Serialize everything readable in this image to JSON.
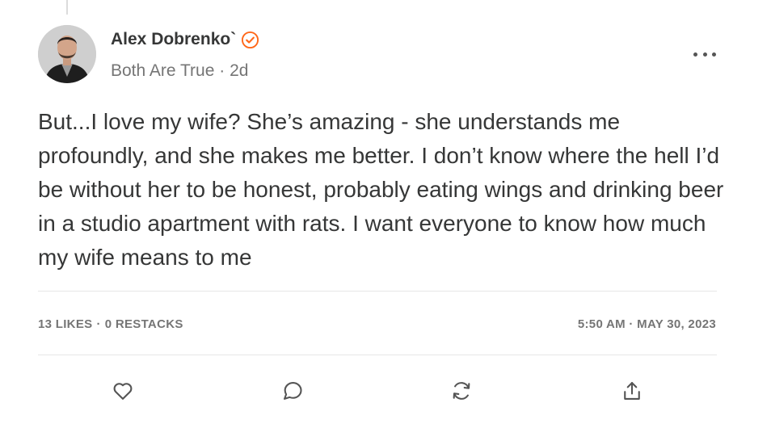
{
  "post": {
    "author_name": "Alex Dobrenko`",
    "publication": "Both Are True",
    "meta_sep": "·",
    "age": "2d",
    "body": "But...I love my wife? She’s amazing - she understands me profoundly, and she makes me better. I don’t know where the hell I’d be without her to be honest, probably eating wings and drinking beer in a studio apartment with rats. I want everyone to know how much my wife means to me"
  },
  "stats": {
    "likes": "13 LIKES",
    "sep": "·",
    "restacks": "0 RESTACKS",
    "timestamp": "5:50 AM · MAY 30, 2023"
  },
  "icons": {
    "verified": "verified-badge-icon",
    "more": "more-horizontal-icon",
    "like": "heart-icon",
    "comment": "comment-icon",
    "restack": "restack-icon",
    "share": "share-icon"
  },
  "colors": {
    "accent": "#FF6719",
    "text": "#363737",
    "muted": "#757575",
    "divider": "#E6E6E6"
  }
}
